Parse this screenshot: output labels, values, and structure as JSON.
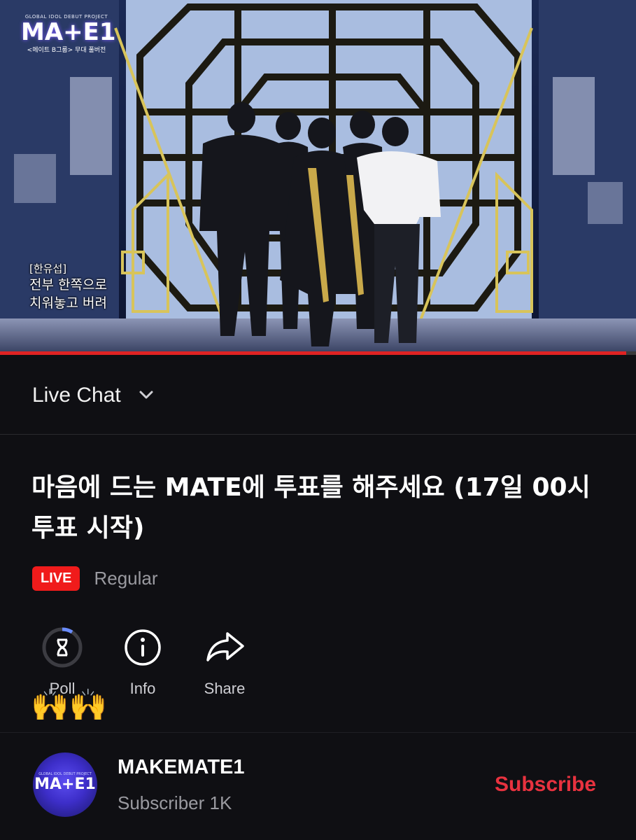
{
  "video": {
    "logo_top": "GLOBAL IDOL DEBUT PROJECT",
    "logo_main": "MA+E1",
    "logo_sub": "<메이트 B그룹> 무대 풀버전",
    "caption_speaker": "[한유섭]",
    "caption_line1": "전부 한쪽으로",
    "caption_line2": "치워놓고 버려",
    "progress": 0.985
  },
  "chat": {
    "label": "Live Chat"
  },
  "stream": {
    "title": "마음에 드는 MATE에 투표를 해주세요 (17일 00시 투표 시작)",
    "live_badge": "LIVE",
    "category": "Regular"
  },
  "actions": [
    {
      "label": "Poll",
      "icon": "hourglass-icon"
    },
    {
      "label": "Info",
      "icon": "info-icon"
    },
    {
      "label": "Share",
      "icon": "share-icon"
    }
  ],
  "emoji": "🙌",
  "channel": {
    "avatar_top": "GLOBAL IDOL DEBUT PROJECT",
    "avatar_main": "MA+E1",
    "name": "MAKEMATE1",
    "subscribers": "Subscriber 1K",
    "subscribe_label": "Subscribe"
  },
  "colors": {
    "live": "#f01b1b",
    "subscribe": "#e8323f",
    "background": "#0f0f13"
  }
}
